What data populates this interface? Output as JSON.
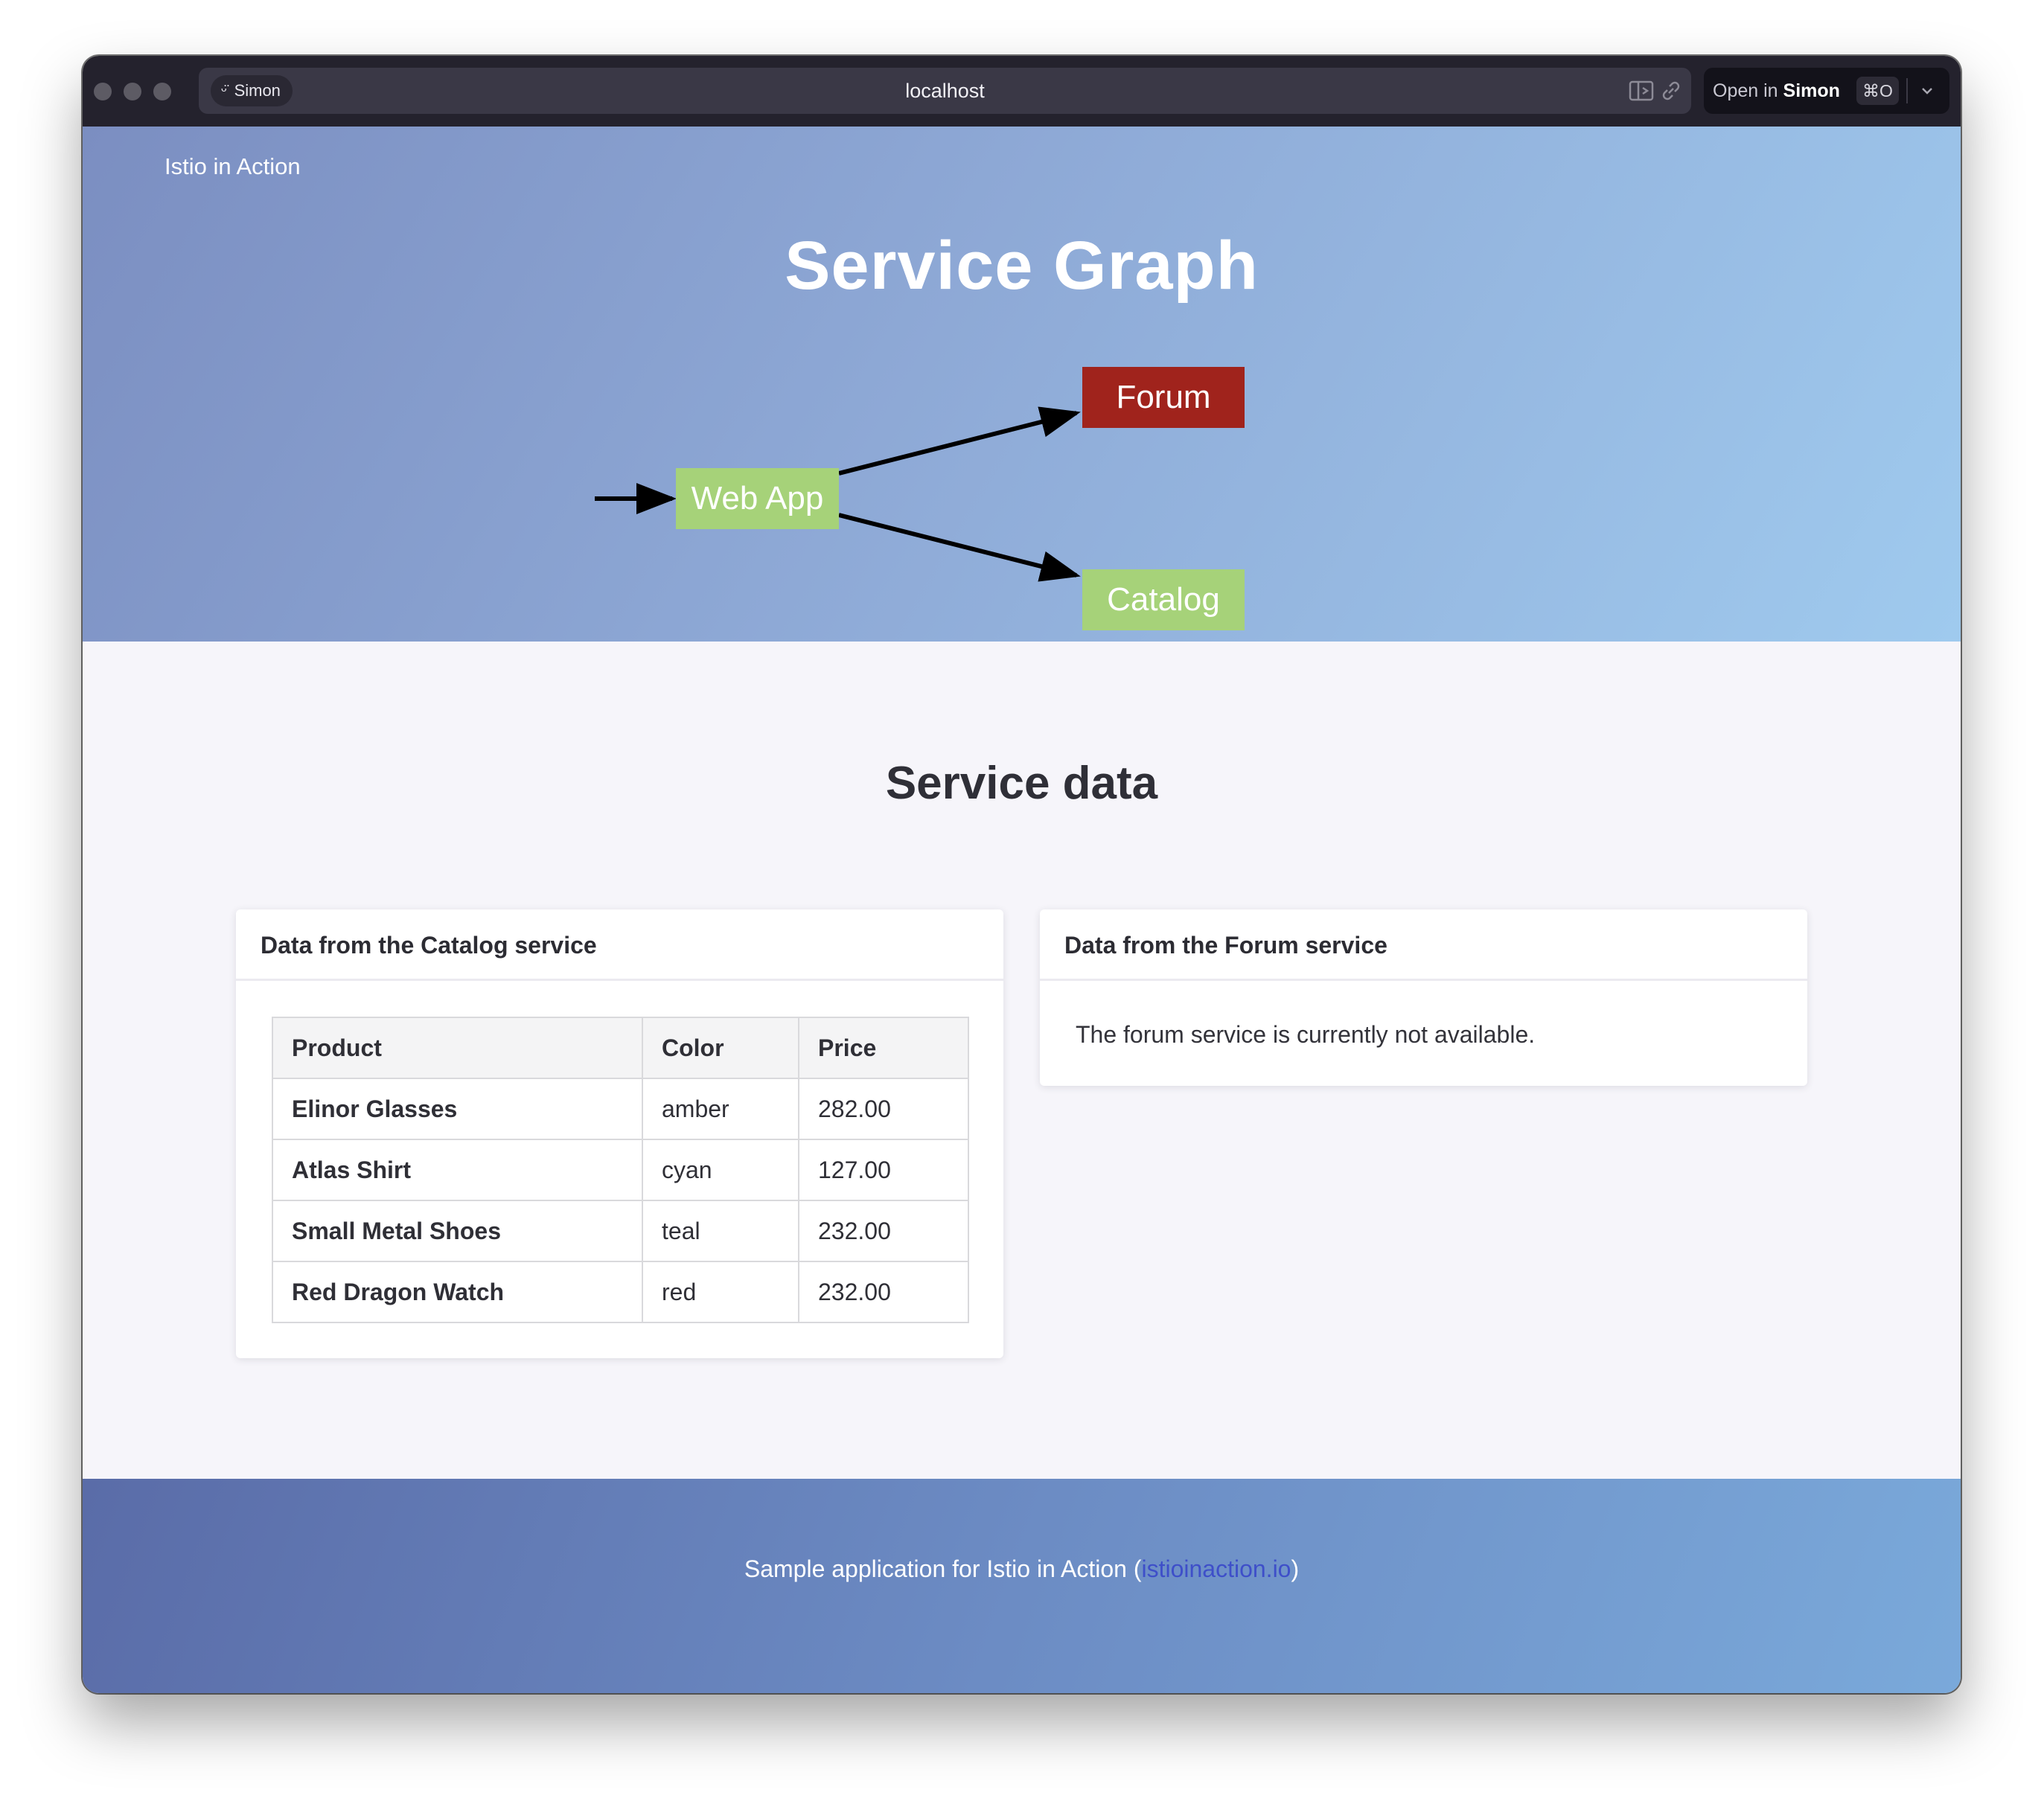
{
  "browser": {
    "profile_name": "Simon",
    "url": "localhost",
    "open_in_prefix": "Open in",
    "open_in_target": "Simon",
    "open_in_shortcut": "⌘O"
  },
  "hero": {
    "brand": "Istio in Action",
    "title": "Service Graph",
    "colors": {
      "healthy": "#a6d279",
      "failed": "#a0231c"
    },
    "nodes": {
      "web_app": {
        "label": "Web App",
        "status": "healthy"
      },
      "forum": {
        "label": "Forum",
        "status": "failed"
      },
      "catalog": {
        "label": "Catalog",
        "status": "healthy"
      }
    }
  },
  "main": {
    "title": "Service data",
    "catalog_card": {
      "title": "Data from the Catalog service",
      "columns": [
        "Product",
        "Color",
        "Price"
      ],
      "rows": [
        {
          "product": "Elinor Glasses",
          "color": "amber",
          "price": "282.00"
        },
        {
          "product": "Atlas Shirt",
          "color": "cyan",
          "price": "127.00"
        },
        {
          "product": "Small Metal Shoes",
          "color": "teal",
          "price": "232.00"
        },
        {
          "product": "Red Dragon Watch",
          "color": "red",
          "price": "232.00"
        }
      ]
    },
    "forum_card": {
      "title": "Data from the Forum service",
      "message": "The forum service is currently not available."
    }
  },
  "footer": {
    "text_before": "Sample application for Istio in Action (",
    "link_text": "istioinaction.io",
    "text_after": ")"
  }
}
